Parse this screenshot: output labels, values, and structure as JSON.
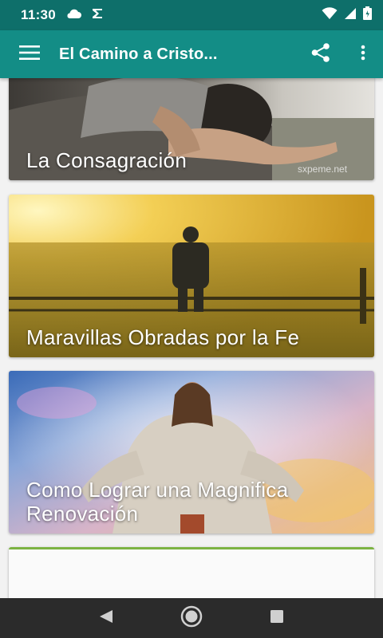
{
  "status": {
    "time": "11:30",
    "left_icons": [
      "cloud-icon",
      "play-store-icon"
    ],
    "right_icons": [
      "wifi-icon",
      "signal-icon",
      "battery-icon"
    ]
  },
  "app_bar": {
    "title": "El Camino a Cristo...",
    "menu_icon": "hamburger-menu-icon",
    "share_icon": "share-icon",
    "more_icon": "more-vert-icon",
    "color": "#138d86",
    "status_color": "#0e6f6a"
  },
  "cards": [
    {
      "title": "La Consagración",
      "watermark": "sxpeme.net"
    },
    {
      "title": "Maravillas Obradas por la Fe"
    },
    {
      "title": "Como Lograr una Magnifica Renovación"
    },
    {
      "title": ""
    }
  ],
  "nav": {
    "back_icon": "back-icon",
    "home_icon": "home-icon",
    "recents_icon": "recents-icon"
  }
}
